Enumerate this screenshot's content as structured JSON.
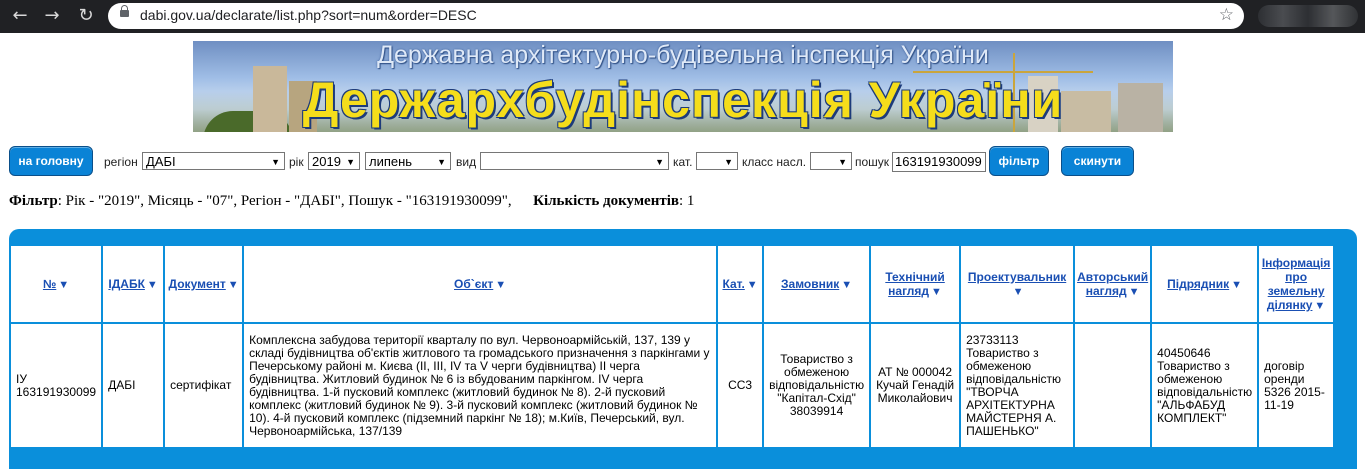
{
  "browser": {
    "url": "dabi.gov.ua/declarate/list.php?sort=num&order=DESC",
    "back_glyph": "←",
    "forward_glyph": "→",
    "reload_glyph": "↻",
    "star_glyph": "☆"
  },
  "banner": {
    "subtitle": "Державна архітектурно-будівельна інспекція України",
    "title": "Держархбудінспекція України"
  },
  "filter_bar": {
    "home_button": "на головну",
    "region_label": "регіон",
    "region_value": "ДАБІ",
    "year_label": "рік",
    "year_value": "2019",
    "month_value": "липень",
    "type_label": "вид",
    "type_value": "",
    "category_label": "кат.",
    "category_value": "",
    "class_label": "класс насл.",
    "class_value": "",
    "search_label": "пошук",
    "search_value": "163191930099",
    "filter_button": "фільтр",
    "reset_button": "скинути"
  },
  "filter_summary": {
    "filter_label": "Фільтр",
    "filter_text": ": Рік - \"2019\", Місяць - \"07\", Регіон - \"ДАБІ\", Пошук - \"163191930099\",",
    "count_label": "Кількість документів",
    "count_value": ": 1"
  },
  "table": {
    "sort_glyph": "▼",
    "headers": [
      "№",
      "ІДАБК",
      "Документ",
      "Об`єкт",
      "Кат.",
      "Замовник",
      "Технічний нагляд",
      "Проектувальник",
      "Авторський нагляд",
      "Підрядник",
      "Інформація про земельну ділянку"
    ],
    "rows": [
      {
        "num": "ІУ 163191930099",
        "idabk": "ДАБІ",
        "document": "сертифікат",
        "object": "Комплексна забудова території кварталу по вул. Червоноармійській, 137, 139 у складі будівництва об'єктів житлового та громадського призначення з паркінгами у Печерському районі м. Києва (ІІ, ІІІ, IV та V черги будівництва) ІІ черга будівництва. Житловий будинок № 6 із вбудованим паркінгом. IV черга будівництва. 1-й пусковий комплекс (житловий будинок № 8). 2-й пусковий комплекс (житловий будинок № 9). 3-й пусковий комплекс (житловий будинок № 10). 4-й пусковий комплекс (підземний паркінг № 18); м.Київ, Печерський, вул. Червоноармійська, 137/139",
        "category": "СС3",
        "customer": "Товариство з обмеженою відповідальністю \"Капітал-Схід\" 38039914",
        "tech_supervision": "АТ № 000042 Кучай Генадій Миколайович",
        "designer": "23733113 Товариство з обмеженою відповідальністю \"ТВОРЧА АРХІТЕКТУРНА МАЙСТЕРНЯ А. ПАШЕНЬКО\"",
        "author_supervision": "",
        "contractor": "40450646 Товариство з обмеженою відповідальністю \"АЛЬФАБУД КОМПЛЕКТ\"",
        "land_info": "договір оренди 5326 2015-11-19"
      }
    ]
  }
}
